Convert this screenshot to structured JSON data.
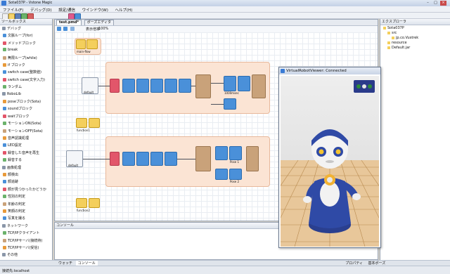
{
  "window": {
    "title": "Sota037P - Vstone Magic",
    "minimize": "–",
    "maximize": "□",
    "close": "×"
  },
  "menu": [
    "ファイル(F)",
    "デバッグ(D)",
    "設定/通信",
    "ウインドウ(W)",
    "ヘルプ(H)"
  ],
  "left_panel": {
    "title": "ツールボックス",
    "items": [
      {
        "label": "デバッグ",
        "cat": true
      },
      {
        "label": "文脈ループ(for)"
      },
      {
        "label": "メソッドブロック"
      },
      {
        "label": "break"
      },
      {
        "label": "無限ループ(while)"
      },
      {
        "label": "if ブロック"
      },
      {
        "label": "switch case(整数値)"
      },
      {
        "label": "switch case(文字入力)"
      },
      {
        "label": "ランダム"
      },
      {
        "label": "RoboLib",
        "cat": true
      },
      {
        "label": "poseブロック(Sota)"
      },
      {
        "label": "soundブロック"
      },
      {
        "label": "waitブロック"
      },
      {
        "label": "モーションON(Sota)"
      },
      {
        "label": "モーションOFF(Sota)"
      },
      {
        "label": "音声認識処理"
      },
      {
        "label": "LED設定"
      },
      {
        "label": "録音した音声を再生"
      },
      {
        "label": "録音する"
      },
      {
        "label": "画像処理",
        "cat": true
      },
      {
        "label": "顔検出"
      },
      {
        "label": "顔追跡"
      },
      {
        "label": "顔が見つかったかどうか"
      },
      {
        "label": "性別の判定"
      },
      {
        "label": "年齢の判定"
      },
      {
        "label": "笑顔の判定"
      },
      {
        "label": "写真を撮る"
      },
      {
        "label": "ネットワーク",
        "cat": true
      },
      {
        "label": "TCP/IPクライアント"
      },
      {
        "label": "TCP/IPサーバ(接続待)"
      },
      {
        "label": "TCP/IPサーバ(受信)"
      },
      {
        "label": "その他",
        "cat": true
      }
    ]
  },
  "editor": {
    "tabs": [
      "test.pmd*",
      "ポーズエディタ"
    ],
    "zoom_label": "表示倍率",
    "zoom_value": "100%",
    "nodes": {
      "top_start": "main-flow",
      "top_default": "default",
      "mid_start": "function1",
      "mid_default": "default",
      "bottom_start": "function2",
      "pose_1": "Pose 1",
      "pose_2": "Pose 2",
      "wait_1": "1000msec",
      "wait_2": "1000msec"
    },
    "console_title": "コンソール"
  },
  "right_panel": {
    "title": "エクスプローラ",
    "items": [
      {
        "label": "Sota037P",
        "indent": 0
      },
      {
        "label": "src",
        "indent": 1
      },
      {
        "label": "jp.co.Vustrek",
        "indent": 2
      },
      {
        "label": "resource",
        "indent": 1
      },
      {
        "label": "Default.jar",
        "indent": 1
      }
    ]
  },
  "viewer": {
    "title": "VirtualRobotViewer: Connected",
    "indicator_colors": [
      "#2e8b3a",
      "#e5e5e5",
      "#2e8b3a"
    ]
  },
  "bottom_tabs": [
    "ウォッチ",
    "コンソール",
    "プロパティ",
    "基本ポーズ"
  ],
  "status": {
    "text": "接続先:localhost"
  },
  "colors": {
    "accent": "#3a7bd5",
    "group": "#fbe4d4",
    "pose": "#4a90d9",
    "condition": "#e2566a",
    "branch": "#c9a27a",
    "start": "#f4cf5c"
  }
}
